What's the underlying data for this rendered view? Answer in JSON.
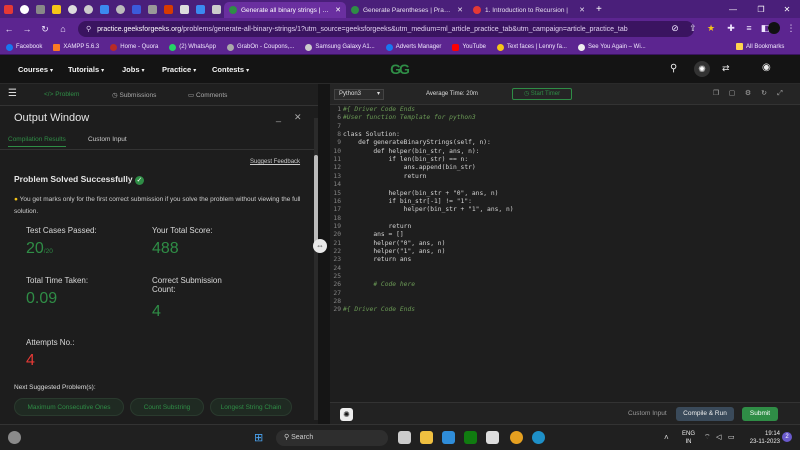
{
  "browser": {
    "tabs": [
      {
        "title": "Generate all binary strings | Prac",
        "active": true
      },
      {
        "title": "Generate Parentheses | Practic",
        "active": false
      },
      {
        "title": "1. Introduction to Recursion |",
        "active": false
      }
    ],
    "url_domain": "practice.geeksforgeeks.org",
    "url_rest": "/problems/generate-all-binary-strings/1?utm_source=geeksforgeeks&utm_medium=ml_article_practice_tab&utm_campaign=article_practice_tab",
    "bookmarks": [
      "Facebook",
      "XAMPP 5.6.3",
      "Home - Quora",
      "(2) WhatsApp",
      "GrabOn - Coupons,...",
      "Samsung Galaxy A1...",
      "Adverts Manager",
      "YouTube",
      "Text faces | Lenny fa...",
      "See You Again – Wi..."
    ],
    "all_bookmarks": "All Bookmarks"
  },
  "gfgnav": {
    "courses": "Courses",
    "tutorials": "Tutorials",
    "jobs": "Jobs",
    "practice": "Practice",
    "contests": "Contests",
    "logo": "GG"
  },
  "problem_tabs": {
    "problem": "Problem",
    "submissions": "Submissions",
    "comments": "Comments"
  },
  "output": {
    "title": "Output Window",
    "tab_compile": "Compilation Results",
    "tab_custom": "Custom Input",
    "suggest": "Suggest Feedback",
    "status": "Problem Solved Successfully",
    "note": "You get marks only for the first correct submission if you solve the problem without viewing the full solution.",
    "test_cases_label": "Test Cases Passed:",
    "test_cases_value": "20",
    "test_cases_total": "/20",
    "score_label": "Your Total Score:",
    "score_value": "488",
    "time_label": "Total Time Taken:",
    "time_value": "0.09",
    "correct_label_1": "Correct Submission",
    "correct_label_2": "Count:",
    "correct_value": "4",
    "attempts_label": "Attempts No.:",
    "attempts_value": "4",
    "next_label": "Next Suggested Problem(s):",
    "suggestions": [
      "Maximum Consecutive Ones",
      "Count Substring",
      "Longest String Chain"
    ]
  },
  "editor": {
    "language": "Python3",
    "avg_time": "Average Time: 20m",
    "start_timer": "Start Timer",
    "code": [
      {
        "n": "1",
        "t": "#{ Driver Code Ends"
      },
      {
        "n": "6",
        "t": "#User function Template for python3"
      },
      {
        "n": "7",
        "t": ""
      },
      {
        "n": "8",
        "t": "class Solution:"
      },
      {
        "n": "9",
        "t": "    def generateBinaryStrings(self, n):"
      },
      {
        "n": "10",
        "t": "        def helper(bin_str, ans, n):"
      },
      {
        "n": "11",
        "t": "            if len(bin_str) == n:"
      },
      {
        "n": "12",
        "t": "                ans.append(bin_str)"
      },
      {
        "n": "13",
        "t": "                return"
      },
      {
        "n": "14",
        "t": ""
      },
      {
        "n": "15",
        "t": "            helper(bin_str + \"0\", ans, n)"
      },
      {
        "n": "16",
        "t": "            if bin_str[-1] != \"1\":"
      },
      {
        "n": "17",
        "t": "                helper(bin_str + \"1\", ans, n)"
      },
      {
        "n": "18",
        "t": ""
      },
      {
        "n": "19",
        "t": "            return"
      },
      {
        "n": "20",
        "t": "        ans = []"
      },
      {
        "n": "21",
        "t": "        helper(\"0\", ans, n)"
      },
      {
        "n": "22",
        "t": "        helper(\"1\", ans, n)"
      },
      {
        "n": "23",
        "t": "        return ans"
      },
      {
        "n": "24",
        "t": ""
      },
      {
        "n": "25",
        "t": ""
      },
      {
        "n": "26",
        "t": "        # Code here"
      },
      {
        "n": "27",
        "t": ""
      },
      {
        "n": "28",
        "t": ""
      },
      {
        "n": "29",
        "t": "#{ Driver Code Ends"
      }
    ],
    "custom_input": "Custom Input",
    "compile_run": "Compile & Run",
    "submit": "Submit"
  },
  "taskbar": {
    "search": "Search",
    "lang": "ENG",
    "region": "IN",
    "time": "19:14",
    "date": "23-11-2023"
  },
  "colors": {
    "gfg_green": "#2f8d46",
    "browser_purple": "#5c2590",
    "error_red": "#e53935"
  }
}
